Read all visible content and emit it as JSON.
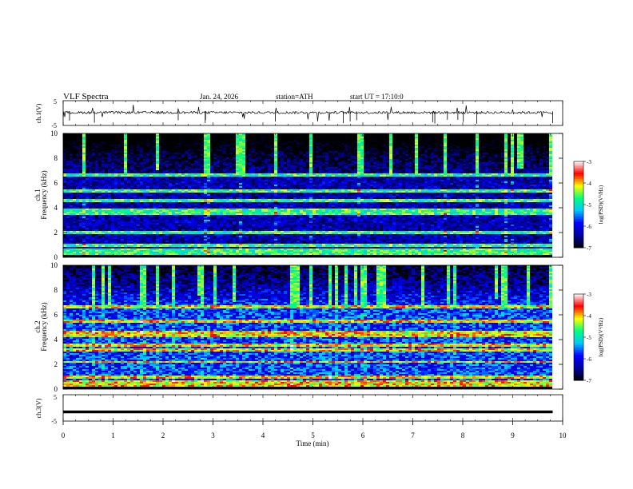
{
  "header": {
    "title": "VLF Spectra",
    "date": "Jan. 24, 2026",
    "station": "station=ATH",
    "start_ut": "start UT =  17:10:0"
  },
  "chart_data": [
    {
      "type": "line",
      "panel": "ch1-waveform",
      "ylabel": "ch.1(V)",
      "ylim": [
        -5,
        5
      ],
      "yticks": [
        "5",
        "-5"
      ],
      "xlim": [
        0,
        10
      ],
      "series": [
        {
          "x": [
            0,
            9.8
          ],
          "y": [
            0.2,
            0.2
          ]
        }
      ],
      "line_color": "#000000"
    },
    {
      "type": "heatmap",
      "panel": "ch1-spectrogram",
      "ylabel": "ch.1\nFrequency (kHz)",
      "ylim": [
        0,
        10
      ],
      "yticks": [
        "0",
        "2",
        "4",
        "6",
        "8",
        "10"
      ],
      "xlim": [
        0,
        10
      ],
      "data_extent_min": 9.8,
      "colorbar": {
        "label": "log(PSD)(V²/Hz)",
        "range": [
          -7,
          -3
        ],
        "ticks": [
          "-3",
          "-4",
          "-5",
          "-6",
          "-7"
        ]
      },
      "bands_khz": [
        0.3,
        0.6,
        1.0,
        2.0,
        3.5,
        3.8,
        4.6,
        5.3,
        6.6
      ],
      "background_level": -6.3
    },
    {
      "type": "heatmap",
      "panel": "ch2-spectrogram",
      "ylabel": "ch.2\nFrequency (kHz)",
      "ylim": [
        0,
        10
      ],
      "yticks": [
        "0",
        "2",
        "4",
        "6",
        "8",
        "10"
      ],
      "xlim": [
        0,
        10
      ],
      "data_extent_min": 9.8,
      "colorbar": {
        "label": "log(PSD)(V²/Hz)",
        "range": [
          -7,
          -3
        ],
        "ticks": [
          "-3",
          "-4",
          "-5",
          "-6",
          "-7"
        ]
      },
      "bands_khz": [
        0.3,
        0.6,
        1.0,
        2.2,
        3.2,
        3.6,
        4.3,
        4.6,
        5.5,
        6.6
      ],
      "background_level": -5.7
    },
    {
      "type": "line",
      "panel": "ch3-waveform",
      "ylabel": "ch.3(V)",
      "ylim": [
        -5,
        5
      ],
      "yticks": [
        "5",
        "-5"
      ],
      "xlim": [
        0,
        10
      ],
      "xticks": [
        "0",
        "1",
        "2",
        "3",
        "4",
        "5",
        "6",
        "7",
        "8",
        "9",
        "10"
      ],
      "xlabel": "Time (min)",
      "series": [
        {
          "x": [
            0,
            9.8
          ],
          "y": [
            -1.5,
            -1.5
          ]
        }
      ],
      "line_color": "#000000"
    }
  ],
  "colors": {
    "colormap": [
      "#000000",
      "#0000a0",
      "#0000ff",
      "#00c8ff",
      "#00ff80",
      "#ffff00",
      "#ff0000",
      "#ffffff"
    ]
  }
}
